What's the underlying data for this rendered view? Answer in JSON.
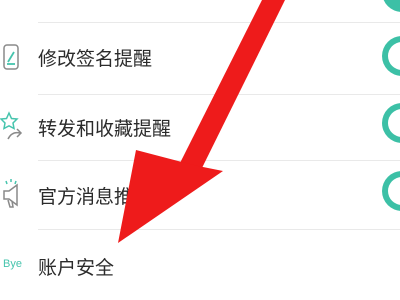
{
  "settings": {
    "items": [
      {
        "label": "修改签名提醒",
        "icon": "signature-icon",
        "toggle_on": true
      },
      {
        "label": "转发和收藏提醒",
        "icon": "star-forward-icon",
        "toggle_on": true
      },
      {
        "label": "官方消息推",
        "icon": "megaphone-icon",
        "toggle_on": true
      },
      {
        "label": "账户安全",
        "icon": "bye-text-icon",
        "icon_text": "Bye"
      }
    ]
  },
  "colors": {
    "accent": "#3cc0a6",
    "arrow": "#ee1b1b",
    "icon_stroke": "#46c4ad",
    "divider": "#e9e9e9",
    "text": "#2b2b2b"
  }
}
